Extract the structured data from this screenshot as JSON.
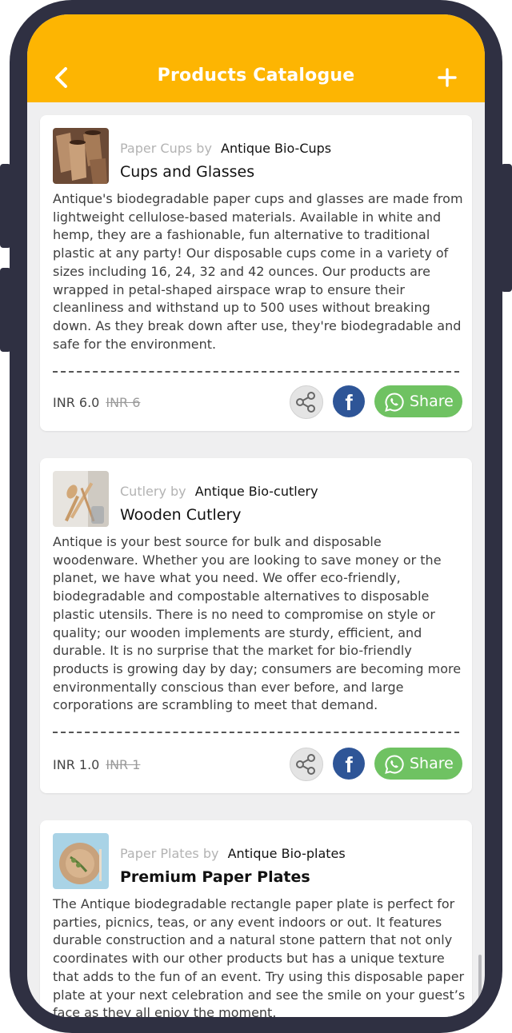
{
  "header": {
    "title": "Products Catalogue"
  },
  "products": [
    {
      "category": "Paper Cups",
      "by": "by",
      "brand": "Antique Bio-Cups",
      "name": "Cups and Glasses",
      "description": "Antique's biodegradable paper cups and glasses are made from lightweight cellulose-based materials. Available in white and hemp, they are a fashionable, fun alternative to traditional plastic at any party! Our disposable cups come in a variety of sizes including 16, 24, 32 and 42 ounces. Our products are wrapped in petal-shaped airspace wrap to ensure their cleanliness and withstand up to 500 uses without breaking down. As they break down after use, they're biodegradable and safe for the environment.",
      "price": "INR 6.0",
      "old_price": "INR 6",
      "share_label": "Share"
    },
    {
      "category": "Cutlery",
      "by": "by",
      "brand": "Antique Bio-cutlery",
      "name": "Wooden Cutlery",
      "description": "Antique is your best source for bulk and disposable woodenware. Whether you are looking to save money or the planet, we have what you need. We offer eco-friendly, biodegradable and compostable alternatives to disposable plastic utensils. There is no need to compromise on style or quality; our wooden implements are sturdy, efficient, and durable. It is no surprise that the market for bio-friendly products is growing day by day; consumers are becoming more environmentally conscious than ever before, and large corporations are scrambling to meet that demand.",
      "price": "INR 1.0",
      "old_price": "INR 1",
      "share_label": "Share"
    },
    {
      "category": "Paper Plates",
      "by": "by",
      "brand": "Antique Bio-plates",
      "name": "Premium Paper Plates",
      "description": "The Antique biodegradable rectangle paper plate is perfect for parties, picnics, teas, or any event indoors or out. It features durable construction and a natural stone pattern that not only coordinates with our other products but has a unique texture that adds to the fun of an event. Try using this disposable paper plate at your next celebration and see the smile on your guest’s face as they all enjoy the moment."
    }
  ],
  "colors": {
    "header": "#fdb502",
    "facebook": "#2e5597",
    "whatsapp": "#6fc262"
  },
  "icons": [
    "back-arrow-icon",
    "plus-icon",
    "share-nodes-icon",
    "facebook-icon",
    "whatsapp-icon"
  ]
}
